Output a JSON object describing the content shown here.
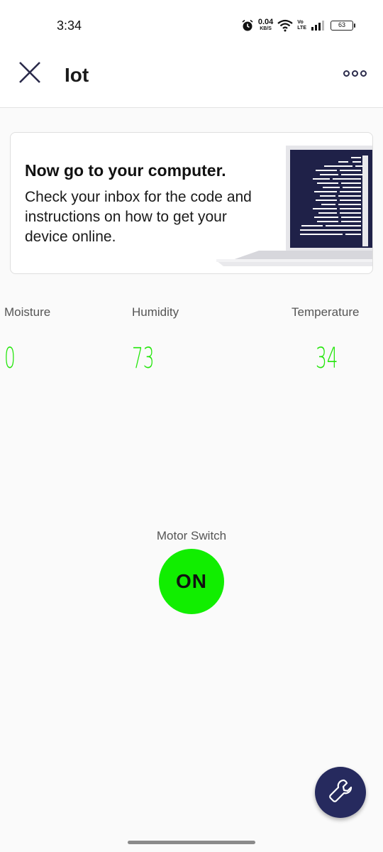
{
  "status_bar": {
    "time": "3:34",
    "net_speed_value": "0.04",
    "net_speed_unit": "KB/S",
    "volte_top": "Vo",
    "volte_bottom": "LTE",
    "battery": "63",
    "icons": [
      "alarm-icon",
      "wifi-icon",
      "signal-icon",
      "battery-icon"
    ]
  },
  "app_bar": {
    "title": "Iot",
    "close_icon": "close-icon",
    "more_icon": "more-icon"
  },
  "banner": {
    "title": "Now go to your computer.",
    "body": "Check your inbox for the code and instructions on how to get your device online.",
    "illustration": "laptop-code-illustration"
  },
  "sensors": [
    {
      "label": "Moisture",
      "value": "0"
    },
    {
      "label": "Humidity",
      "value": "73"
    },
    {
      "label": "Temperature",
      "value": "34"
    }
  ],
  "motor": {
    "label": "Motor Switch",
    "button_label": "ON"
  },
  "fab": {
    "icon": "wrench-icon"
  },
  "colors": {
    "accent_green": "#22e60a",
    "switch_on": "#11ee00",
    "fab_navy": "#262a5e",
    "title_navy": "#2a2a4a"
  }
}
